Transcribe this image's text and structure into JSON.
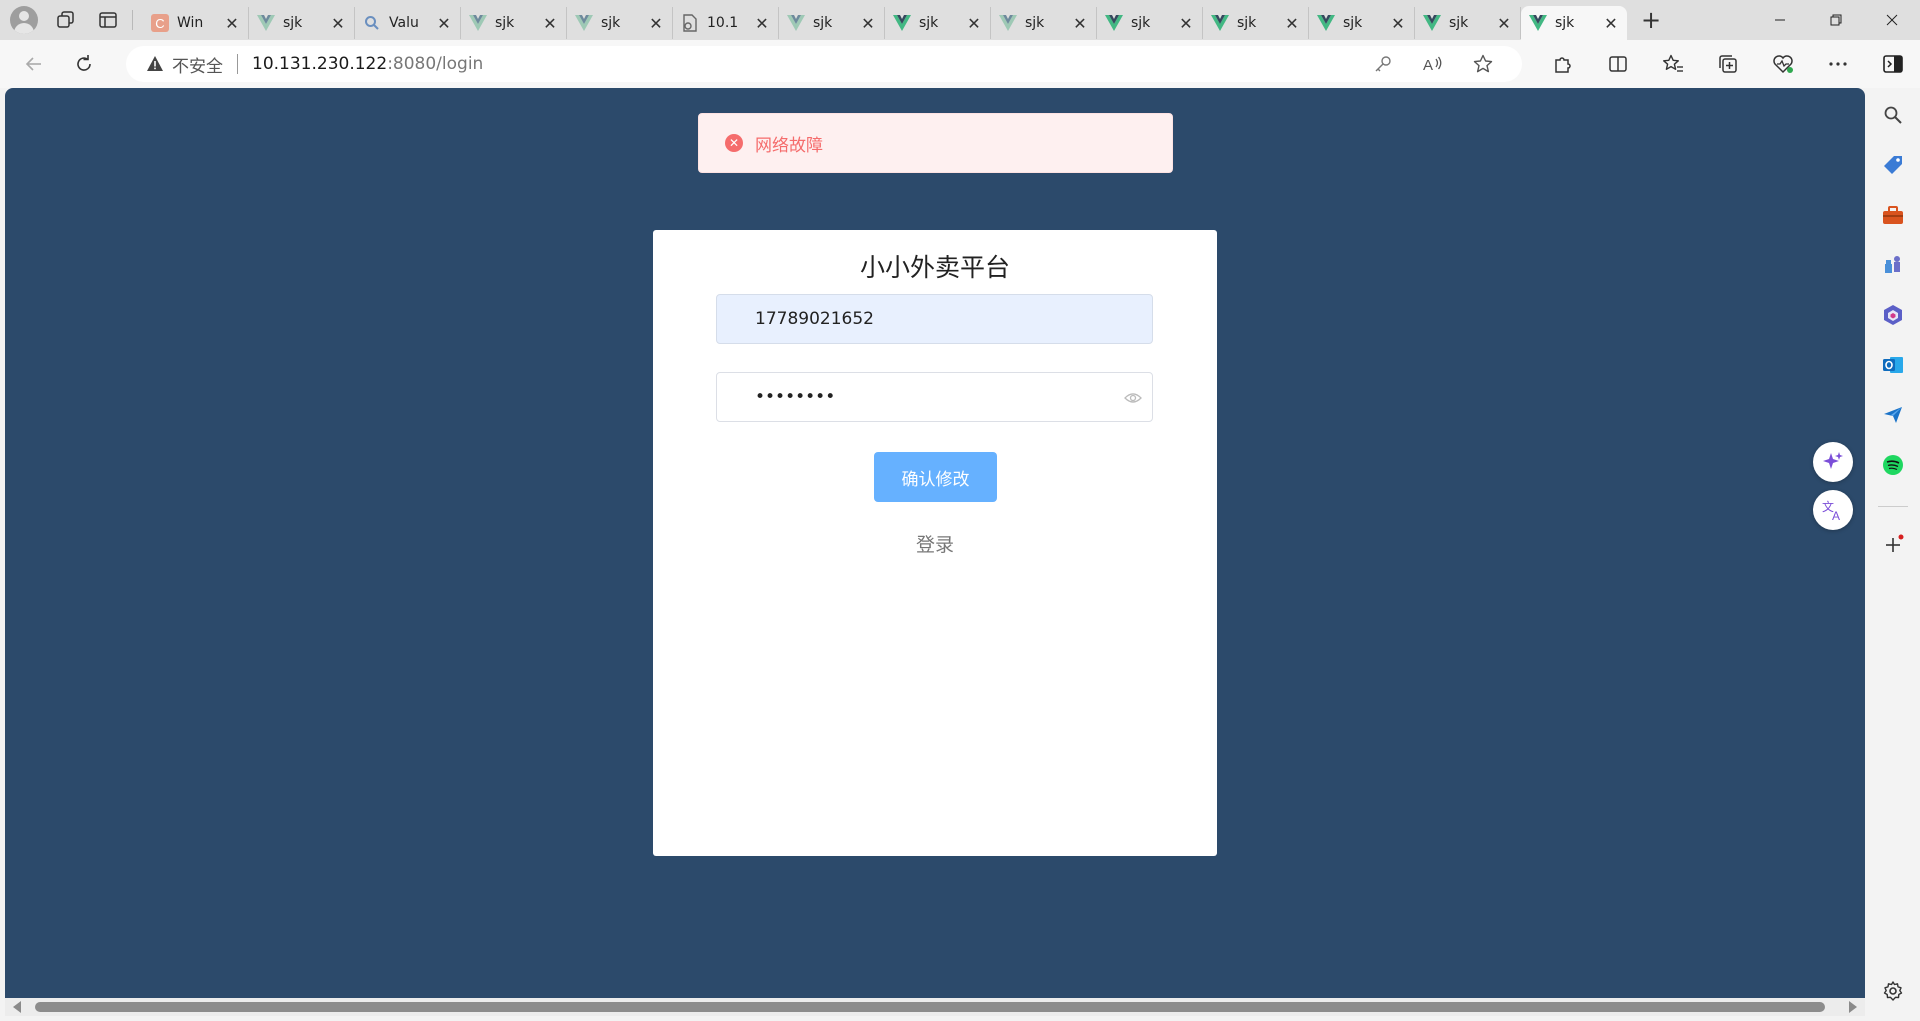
{
  "browser": {
    "tabs": [
      {
        "label": "Win",
        "favicon": "c-letter-icon",
        "active": false
      },
      {
        "label": "sjk",
        "favicon": "vue-icon",
        "active": false
      },
      {
        "label": "Valu",
        "favicon": "search-icon",
        "active": false
      },
      {
        "label": "sjk",
        "favicon": "vue-icon",
        "active": false
      },
      {
        "label": "sjk",
        "favicon": "vue-icon",
        "active": false
      },
      {
        "label": "10.1",
        "favicon": "document-icon",
        "active": false
      },
      {
        "label": "sjk",
        "favicon": "vue-icon",
        "active": false
      },
      {
        "label": "sjk",
        "favicon": "vue-icon",
        "active": false
      },
      {
        "label": "sjk",
        "favicon": "vue-icon",
        "active": false
      },
      {
        "label": "sjk",
        "favicon": "vue-icon",
        "active": false
      },
      {
        "label": "sjk",
        "favicon": "vue-icon",
        "active": false
      },
      {
        "label": "sjk",
        "favicon": "vue-icon",
        "active": false
      },
      {
        "label": "sjk",
        "favicon": "vue-icon",
        "active": false
      },
      {
        "label": "sjk",
        "favicon": "vue-icon",
        "active": true
      }
    ],
    "address": {
      "security_label": "不安全",
      "host": "10.131.230.122",
      "path": ":8080/login"
    }
  },
  "page": {
    "error_message": "网络故障",
    "title": "小小外卖平台",
    "phone_value": "17789021652",
    "password_value": "••••••••",
    "confirm_button": "确认修改",
    "login_link": "登录"
  },
  "colors": {
    "page_background": "#2c4a6b",
    "error_text": "#f56c6c",
    "error_background": "#fef0f0",
    "primary_button": "#66b1ff",
    "autofill_background": "#e8f0fe"
  }
}
